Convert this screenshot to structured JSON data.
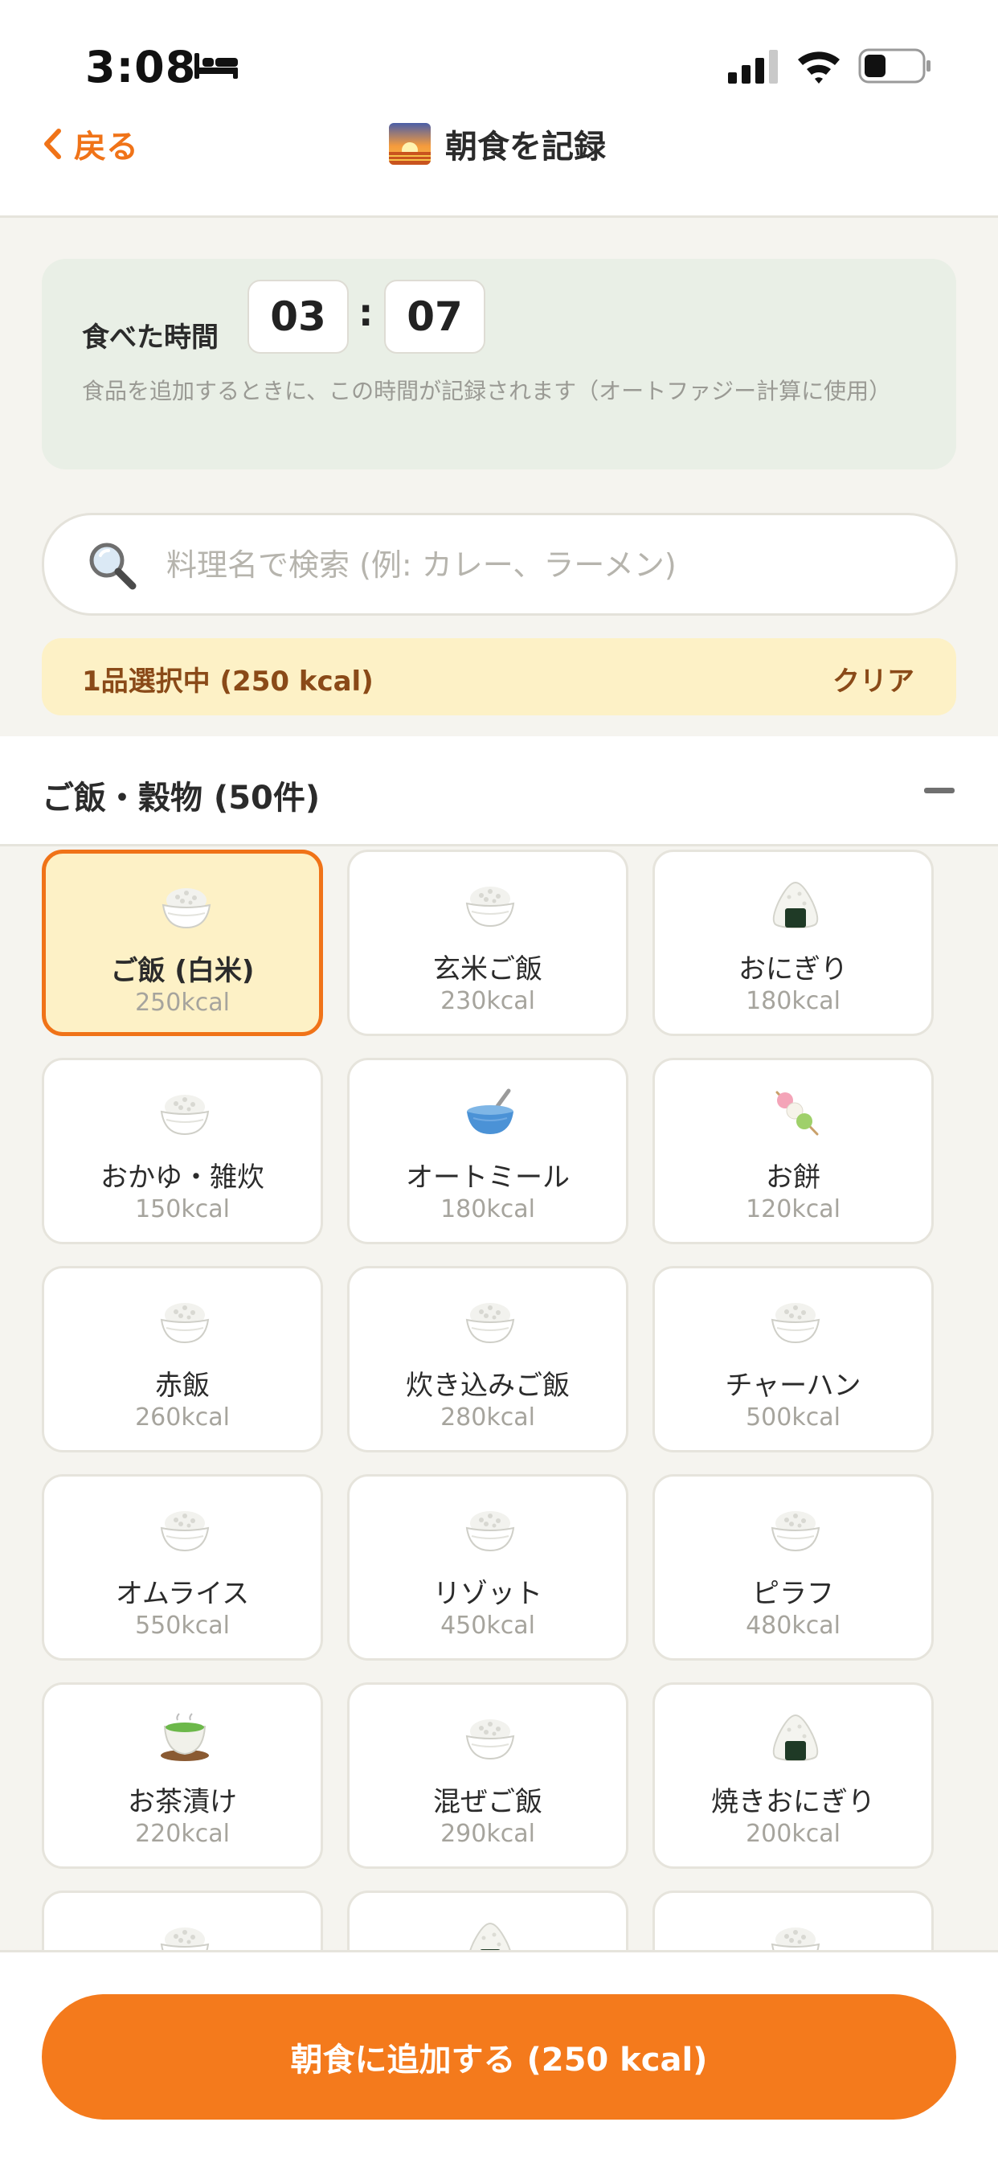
{
  "status_bar": {
    "time": "3:08"
  },
  "nav": {
    "back_label": "戻る",
    "title": "朝食を記録"
  },
  "time_card": {
    "label": "食べた時間",
    "hour": "03",
    "separator": ":",
    "minute": "07",
    "note": "食品を追加するときに、この時間が記録されます（オートファジー計算に使用）"
  },
  "search": {
    "placeholder": "料理名で検索 (例: カレー、ラーメン)"
  },
  "selection": {
    "summary": "1品選択中 (250 kcal)",
    "clear_label": "クリア"
  },
  "category": {
    "title": "ご飯・穀物 (50件)"
  },
  "foods": [
    {
      "name": "ご飯 (白米)",
      "kcal": "250kcal",
      "icon": "rice-bowl-icon",
      "selected": true
    },
    {
      "name": "玄米ご飯",
      "kcal": "230kcal",
      "icon": "rice-bowl-icon",
      "selected": false
    },
    {
      "name": "おにぎり",
      "kcal": "180kcal",
      "icon": "onigiri-icon",
      "selected": false
    },
    {
      "name": "おかゆ・雑炊",
      "kcal": "150kcal",
      "icon": "rice-bowl-icon",
      "selected": false
    },
    {
      "name": "オートミール",
      "kcal": "180kcal",
      "icon": "blue-bowl-icon",
      "selected": false
    },
    {
      "name": "お餅",
      "kcal": "120kcal",
      "icon": "dango-icon",
      "selected": false
    },
    {
      "name": "赤飯",
      "kcal": "260kcal",
      "icon": "rice-bowl-icon",
      "selected": false
    },
    {
      "name": "炊き込みご飯",
      "kcal": "280kcal",
      "icon": "rice-bowl-icon",
      "selected": false
    },
    {
      "name": "チャーハン",
      "kcal": "500kcal",
      "icon": "rice-bowl-icon",
      "selected": false
    },
    {
      "name": "オムライス",
      "kcal": "550kcal",
      "icon": "rice-bowl-icon",
      "selected": false
    },
    {
      "name": "リゾット",
      "kcal": "450kcal",
      "icon": "rice-bowl-icon",
      "selected": false
    },
    {
      "name": "ピラフ",
      "kcal": "480kcal",
      "icon": "rice-bowl-icon",
      "selected": false
    },
    {
      "name": "お茶漬け",
      "kcal": "220kcal",
      "icon": "green-tea-icon",
      "selected": false
    },
    {
      "name": "混ぜご飯",
      "kcal": "290kcal",
      "icon": "rice-bowl-icon",
      "selected": false
    },
    {
      "name": "焼きおにぎり",
      "kcal": "200kcal",
      "icon": "onigiri-icon",
      "selected": false
    },
    {
      "name": "",
      "kcal": "",
      "icon": "rice-bowl-icon",
      "selected": false
    },
    {
      "name": "",
      "kcal": "",
      "icon": "onigiri-icon",
      "selected": false
    },
    {
      "name": "",
      "kcal": "",
      "icon": "rice-bowl-icon",
      "selected": false
    }
  ],
  "footer": {
    "add_label": "朝食に追加する (250 kcal)"
  },
  "colors": {
    "accent": "#f47a1c",
    "selected_bg": "#fdf1c6",
    "time_card_bg": "#e9efe6"
  }
}
